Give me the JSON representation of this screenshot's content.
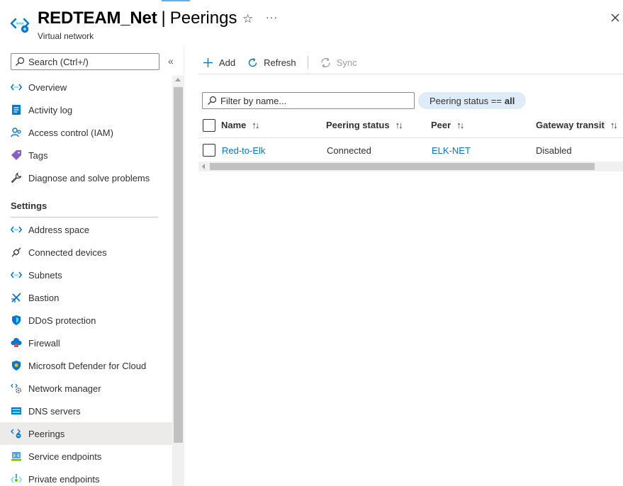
{
  "header": {
    "resource_name": "REDTEAM_Net",
    "separator": "|",
    "page_name": "Peerings",
    "resource_type": "Virtual network",
    "favorite_icon": "star-icon",
    "more_label": "···"
  },
  "sidebar": {
    "search_placeholder": "Search (Ctrl+/)",
    "collapse_label": "«",
    "top_items": [
      {
        "label": "Overview",
        "icon": "vnet-icon"
      },
      {
        "label": "Activity log",
        "icon": "activity-log-icon"
      },
      {
        "label": "Access control (IAM)",
        "icon": "iam-icon"
      },
      {
        "label": "Tags",
        "icon": "tag-icon"
      },
      {
        "label": "Diagnose and solve problems",
        "icon": "wrench-icon"
      }
    ],
    "settings_heading": "Settings",
    "settings_items": [
      {
        "label": "Address space",
        "icon": "vnet-icon"
      },
      {
        "label": "Connected devices",
        "icon": "plug-icon"
      },
      {
        "label": "Subnets",
        "icon": "vnet-icon"
      },
      {
        "label": "Bastion",
        "icon": "bastion-icon"
      },
      {
        "label": "DDoS protection",
        "icon": "shield-icon"
      },
      {
        "label": "Firewall",
        "icon": "firewall-icon"
      },
      {
        "label": "Microsoft Defender for Cloud",
        "icon": "defender-icon"
      },
      {
        "label": "Network manager",
        "icon": "network-manager-icon"
      },
      {
        "label": "DNS servers",
        "icon": "dns-icon"
      },
      {
        "label": "Peerings",
        "icon": "peerings-icon",
        "active": true
      },
      {
        "label": "Service endpoints",
        "icon": "service-endpoint-icon"
      },
      {
        "label": "Private endpoints",
        "icon": "private-endpoint-icon"
      }
    ]
  },
  "toolbar": {
    "add_label": "Add",
    "refresh_label": "Refresh",
    "sync_label": "Sync"
  },
  "filter": {
    "placeholder": "Filter by name...",
    "pill_prefix": "Peering status ==",
    "pill_value": "all"
  },
  "table": {
    "columns": [
      "Name",
      "Peering status",
      "Peer",
      "Gateway transit"
    ],
    "sort_glyph": "↑↓",
    "rows": [
      {
        "name": "Red-to-Elk",
        "status": "Connected",
        "peer": "ELK-NET",
        "gateway_transit": "Disabled"
      }
    ]
  },
  "colors": {
    "accent": "#0078d4",
    "pill_bg": "#deecf9",
    "active_nav_bg": "#edebe9"
  }
}
